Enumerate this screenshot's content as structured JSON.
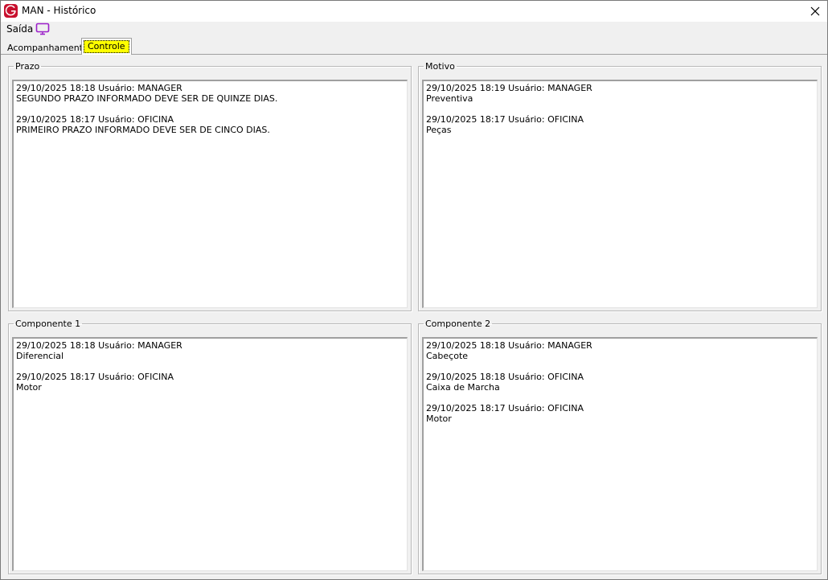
{
  "window": {
    "title": "MAN - Histórico",
    "app_icon": "g-logo-icon",
    "accent_color": "#c8102e"
  },
  "menu": {
    "saida_label": "Saída",
    "monitor_icon": "monitor-icon"
  },
  "tabs": [
    {
      "label": "Acompanhamento",
      "active": false
    },
    {
      "label": "Controle",
      "active": true
    }
  ],
  "groups": {
    "prazo": {
      "title": "Prazo",
      "entries": [
        {
          "header": "29/10/2025 18:18 Usuário: MANAGER",
          "text": "SEGUNDO PRAZO INFORMADO DEVE SER DE QUINZE DIAS."
        },
        {
          "header": "29/10/2025 18:17 Usuário: OFICINA",
          "text": "PRIMEIRO PRAZO INFORMADO DEVE SER DE CINCO DIAS."
        }
      ]
    },
    "motivo": {
      "title": "Motivo",
      "entries": [
        {
          "header": "29/10/2025 18:19 Usuário: MANAGER",
          "text": "Preventiva"
        },
        {
          "header": "29/10/2025 18:17 Usuário: OFICINA",
          "text": "Peças"
        }
      ]
    },
    "componente1": {
      "title": "Componente 1",
      "entries": [
        {
          "header": "29/10/2025 18:18 Usuário: MANAGER",
          "text": "Diferencial"
        },
        {
          "header": "29/10/2025 18:17 Usuário: OFICINA",
          "text": "Motor"
        }
      ]
    },
    "componente2": {
      "title": "Componente 2",
      "entries": [
        {
          "header": "29/10/2025 18:18 Usuário: MANAGER",
          "text": "Cabeçote"
        },
        {
          "header": "29/10/2025 18:18 Usuário: OFICINA",
          "text": "Caixa de Marcha"
        },
        {
          "header": "29/10/2025 18:17 Usuário: OFICINA",
          "text": "Motor"
        }
      ]
    }
  }
}
